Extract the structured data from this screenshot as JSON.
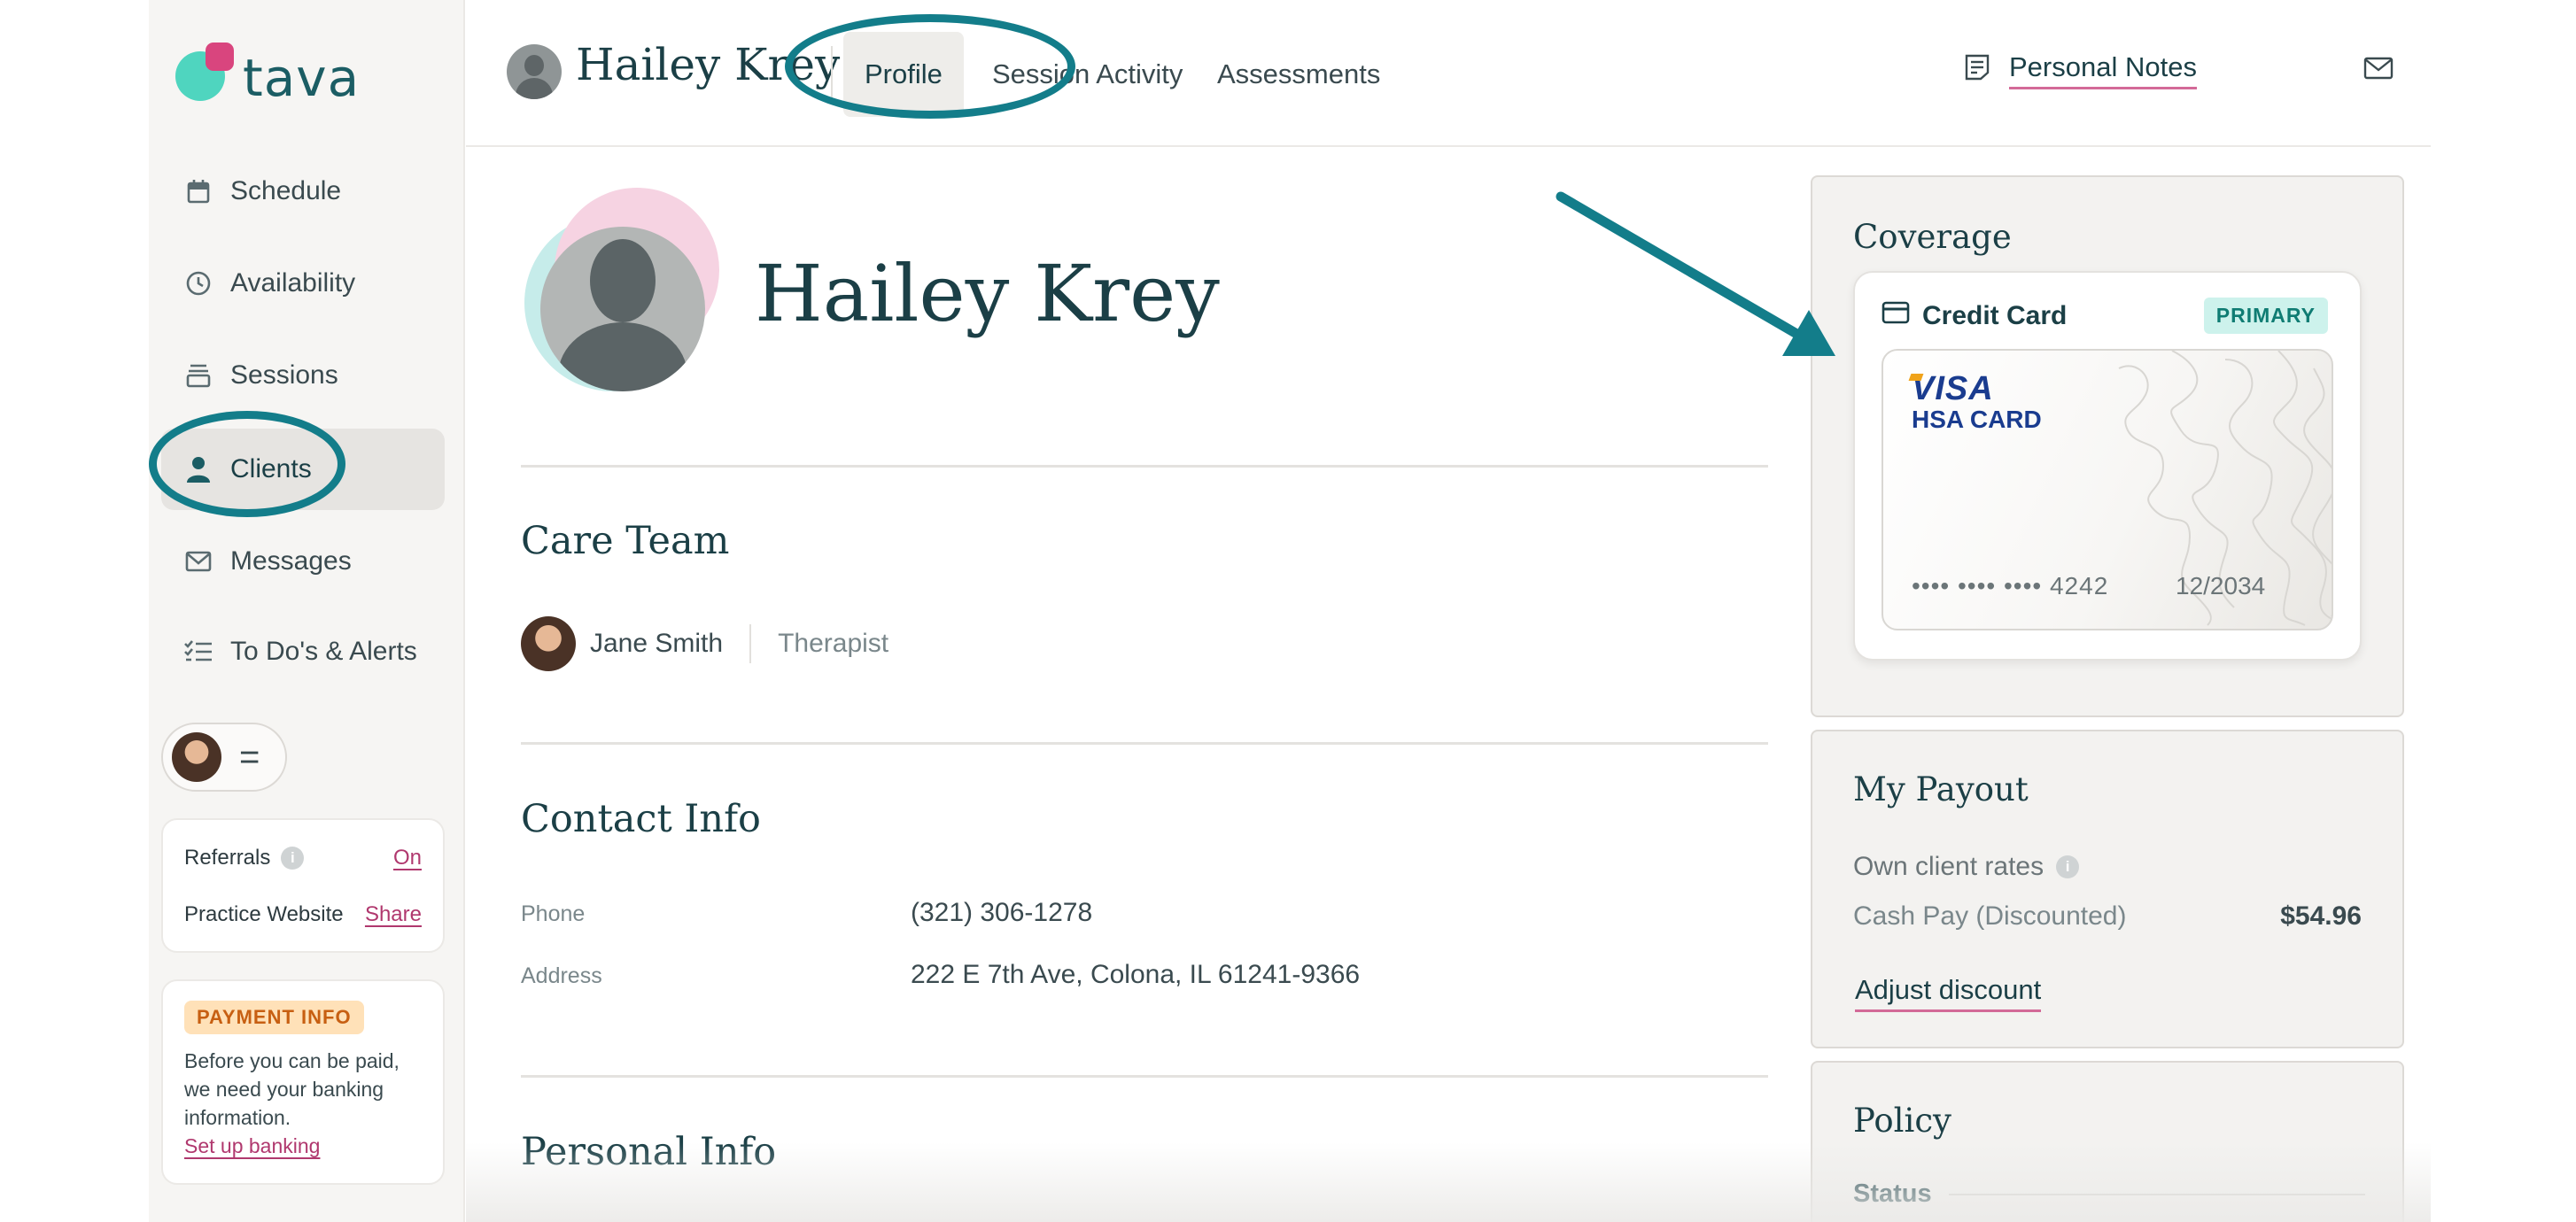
{
  "brand": {
    "name": "tava"
  },
  "sidebar": {
    "items": [
      {
        "label": "Schedule",
        "icon": "calendar-icon"
      },
      {
        "label": "Availability",
        "icon": "clock-icon"
      },
      {
        "label": "Sessions",
        "icon": "stack-icon"
      },
      {
        "label": "Clients",
        "icon": "person-icon",
        "active": true
      },
      {
        "label": "Messages",
        "icon": "mail-icon"
      },
      {
        "label": "To Do's & Alerts",
        "icon": "checklist-icon"
      }
    ],
    "user_menu_icon": "=",
    "settings": {
      "referrals_label": "Referrals",
      "referrals_value": "On",
      "website_label": "Practice Website",
      "website_value": "Share"
    },
    "payment": {
      "badge": "PAYMENT INFO",
      "text": "Before you can be paid, we need your banking information.",
      "link": "Set up banking"
    }
  },
  "topbar": {
    "client_name": "Hailey Krey",
    "tabs": [
      {
        "label": "Profile",
        "active": true
      },
      {
        "label": "Session Activity"
      },
      {
        "label": "Assessments"
      }
    ],
    "notes_label": "Personal Notes"
  },
  "profile": {
    "name": "Hailey Krey",
    "care_team": {
      "title": "Care Team",
      "members": [
        {
          "name": "Jane Smith",
          "role": "Therapist"
        }
      ]
    },
    "contact": {
      "title": "Contact Info",
      "phone_label": "Phone",
      "phone": "(321) 306-1278",
      "address_label": "Address",
      "address": "222 E 7th Ave, Colona, IL 61241-9366"
    },
    "personal": {
      "title": "Personal Info"
    }
  },
  "coverage": {
    "title": "Coverage",
    "method": "Credit Card",
    "badge": "PRIMARY",
    "card": {
      "brand": "VISA",
      "type": "HSA CARD",
      "number": "•••• •••• •••• 4242",
      "expiry": "12/2034"
    }
  },
  "payout": {
    "title": "My Payout",
    "rates_label": "Own client rates",
    "rate_name": "Cash Pay (Discounted)",
    "rate_amount": "$54.96",
    "adjust_label": "Adjust discount"
  },
  "policy": {
    "title": "Policy",
    "status_label": "Status"
  },
  "colors": {
    "brand_teal": "#1b5d64",
    "annotation_teal": "#137d8a",
    "accent_pink": "#d36a98",
    "primary_badge_bg": "#cdf2ec",
    "payment_badge_bg": "#ffe1b8"
  }
}
